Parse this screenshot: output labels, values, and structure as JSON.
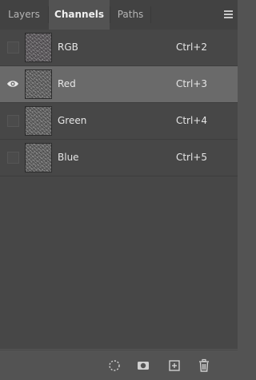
{
  "tabs": [
    {
      "label": "Layers",
      "active": false
    },
    {
      "label": "Channels",
      "active": true
    },
    {
      "label": "Paths",
      "active": false
    }
  ],
  "panel_menu_icon": "hamburger-menu-icon",
  "channels": [
    {
      "name": "RGB",
      "shortcut": "Ctrl+2",
      "visible": false,
      "selected": false
    },
    {
      "name": "Red",
      "shortcut": "Ctrl+3",
      "visible": true,
      "selected": true
    },
    {
      "name": "Green",
      "shortcut": "Ctrl+4",
      "visible": false,
      "selected": false
    },
    {
      "name": "Blue",
      "shortcut": "Ctrl+5",
      "visible": false,
      "selected": false
    }
  ],
  "footer_buttons": [
    {
      "icon": "load-selection-icon"
    },
    {
      "icon": "save-selection-as-mask-icon"
    },
    {
      "icon": "new-channel-icon"
    },
    {
      "icon": "delete-channel-icon"
    }
  ],
  "colors": {
    "panel_bg": "#535353",
    "list_bg": "#474747",
    "selected_row_bg": "#6a6a6a",
    "tabbar_bg": "#424242",
    "text": "#e6e6e6"
  }
}
